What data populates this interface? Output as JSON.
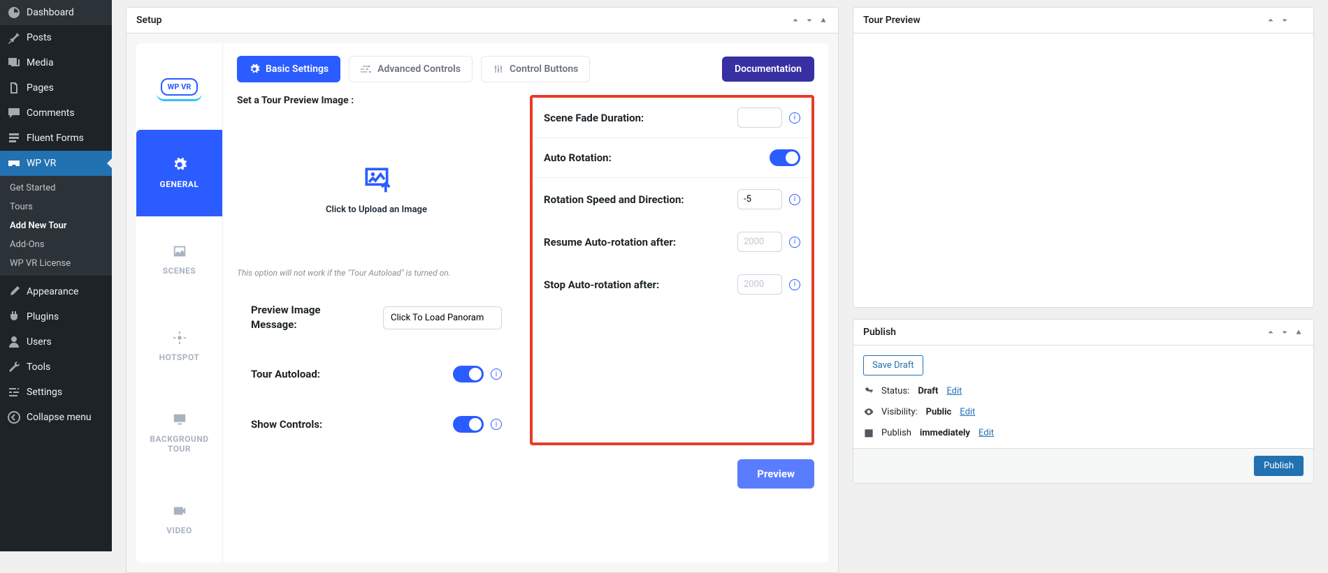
{
  "sidebar": {
    "items": [
      {
        "label": "Dashboard"
      },
      {
        "label": "Posts"
      },
      {
        "label": "Media"
      },
      {
        "label": "Pages"
      },
      {
        "label": "Comments"
      },
      {
        "label": "Fluent Forms"
      },
      {
        "label": "WP VR"
      }
    ],
    "submenu": [
      {
        "label": "Get Started"
      },
      {
        "label": "Tours"
      },
      {
        "label": "Add New Tour"
      },
      {
        "label": "Add-Ons"
      },
      {
        "label": "WP VR License"
      }
    ],
    "bottom": [
      {
        "label": "Appearance"
      },
      {
        "label": "Plugins"
      },
      {
        "label": "Users"
      },
      {
        "label": "Tools"
      },
      {
        "label": "Settings"
      },
      {
        "label": "Collapse menu"
      }
    ]
  },
  "setup": {
    "title": "Setup",
    "logo": "WP VR",
    "nav": [
      {
        "label": "GENERAL"
      },
      {
        "label": "SCENES"
      },
      {
        "label": "HOTSPOT"
      },
      {
        "label": "BACKGROUND TOUR"
      },
      {
        "label": "VIDEO"
      }
    ],
    "tabs": {
      "basic": "Basic Settings",
      "advanced": "Advanced Controls",
      "control": "Control Buttons"
    },
    "doc": "Documentation",
    "left": {
      "previewLabel": "Set a Tour Preview Image :",
      "uploadText": "Click to Upload an Image",
      "uploadHint": "This option will not work if the \"Tour Autoload\" is turned on.",
      "previewMsgLabel": "Preview Image Message:",
      "previewMsgValue": "Click To Load Panoram",
      "autoloadLabel": "Tour Autoload:",
      "showControlsLabel": "Show Controls:"
    },
    "right": {
      "fadeLabel": "Scene Fade Duration:",
      "fadeValue": "",
      "autoRotationLabel": "Auto Rotation:",
      "speedLabel": "Rotation Speed and Direction:",
      "speedValue": "-5",
      "resumeLabel": "Resume Auto-rotation after:",
      "resumePlaceholder": "2000",
      "stopLabel": "Stop Auto-rotation after:",
      "stopPlaceholder": "2000"
    },
    "previewBtn": "Preview"
  },
  "tourPreview": {
    "title": "Tour Preview"
  },
  "publish": {
    "title": "Publish",
    "saveDraft": "Save Draft",
    "statusLabel": "Status:",
    "statusValue": "Draft",
    "visibilityLabel": "Visibility:",
    "visibilityValue": "Public",
    "publishLabel": "Publish",
    "publishValue": "immediately",
    "edit": "Edit",
    "publishBtn": "Publish"
  }
}
